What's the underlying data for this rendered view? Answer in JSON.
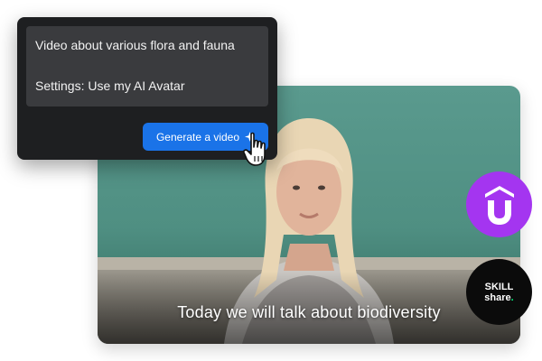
{
  "prompt": {
    "line1": "Video about various flora and fauna",
    "line2": "Settings: Use my AI Avatar"
  },
  "generate_button": {
    "label": "Generate a video",
    "icon": "sparkle-icon"
  },
  "cursor_icon": "hand-pointer-icon",
  "video": {
    "caption": "Today we will talk about biodiversity"
  },
  "logos": {
    "udemy": {
      "icon": "udemy-logo",
      "color": "#a435f0"
    },
    "skillshare": {
      "line1": "SKILL",
      "line2": "share",
      "accent": "#00ff84"
    }
  },
  "colors": {
    "panel": "#1e1f21",
    "prompt_box": "#3a3b3e",
    "button": "#1a73e8",
    "chalkboard": "#4f8f82"
  }
}
